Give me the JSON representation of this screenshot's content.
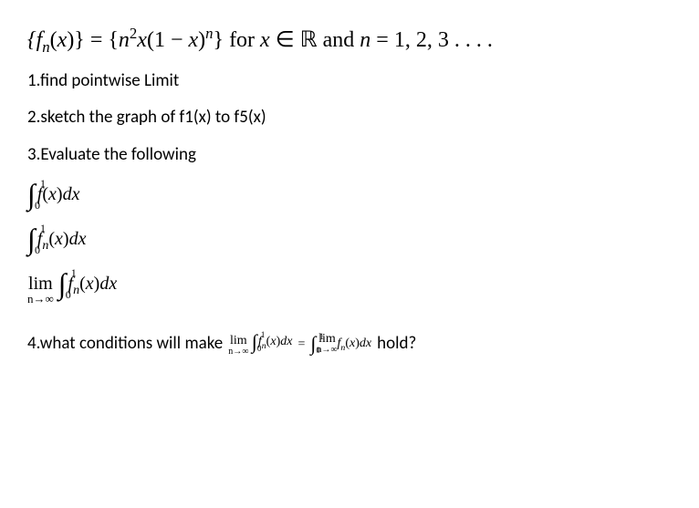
{
  "def": {
    "lhs": "{ fₙ(x) }",
    "eq": " = ",
    "rhs": "{ n²x(1 − x)ⁿ }",
    "for": " for ",
    "xin": "x ∈ ℝ",
    "and": " and ",
    "ncond": "n = 1, 2, 3 . . . ."
  },
  "q1": "1.find pointwise Limit",
  "q2": "2.sketch the graph of f1(x) to f5(x)",
  "q3": "3.Evaluate the following",
  "eq1": {
    "integrand": "f(x)dx",
    "lo": "0",
    "up": "1"
  },
  "eq2": {
    "integrand": "fₙ(x)dx",
    "lo": "0",
    "up": "1"
  },
  "eq3": {
    "lim": "lim",
    "sub": "n→∞",
    "integrand": "fₙ(x)dx",
    "lo": "0",
    "up": "1"
  },
  "q4": {
    "pre": "4.what conditions will make",
    "lhs": {
      "lim": "lim",
      "sub": "n→∞",
      "integrand": "fₙ(x)dx",
      "lo": "0",
      "up": "1"
    },
    "eq": " = ",
    "rhs": {
      "lim": "lim",
      "sub": "n→∞",
      "integrand": "fₙ(x)dx",
      "lo": "0",
      "up": "1"
    },
    "post": "hold?"
  }
}
